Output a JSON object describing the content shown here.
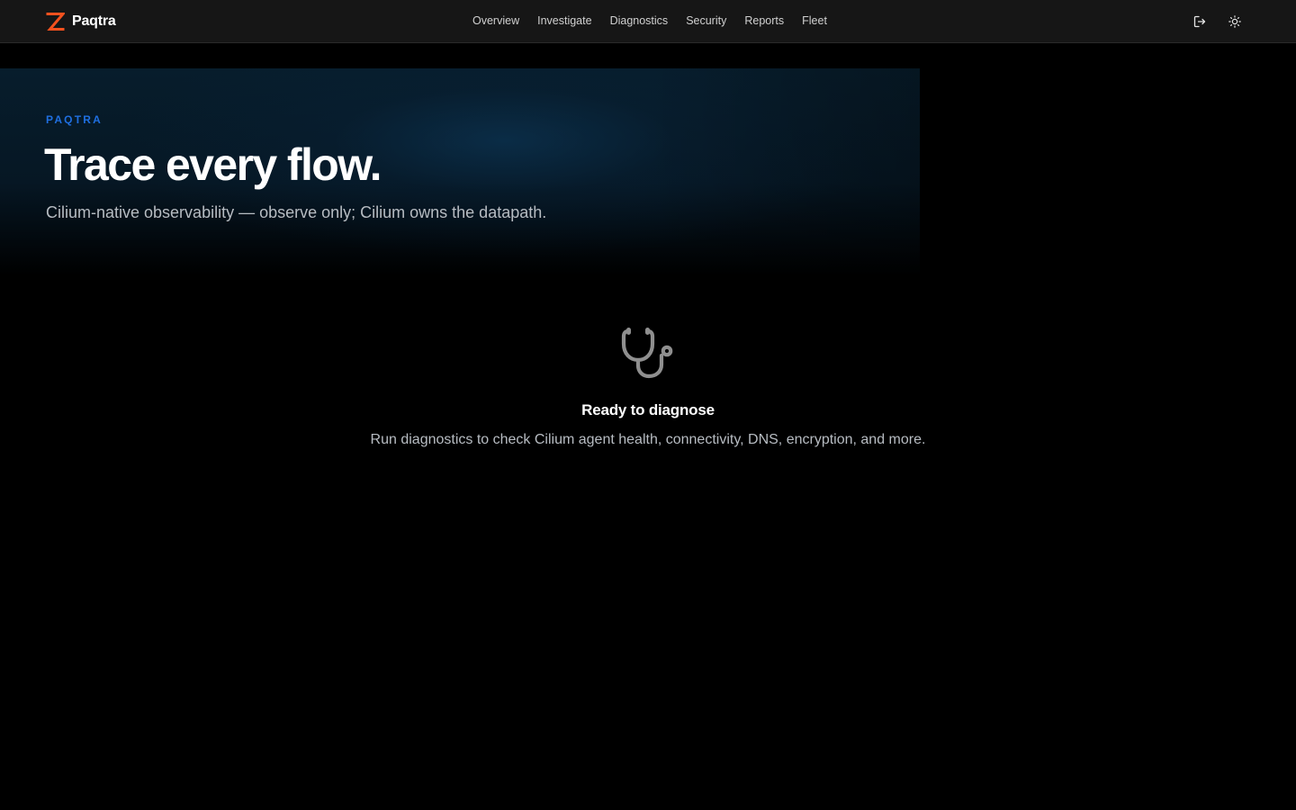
{
  "header": {
    "brand": {
      "name": "Paqtra",
      "logo_icon": "z-logo-icon",
      "logo_color": "#f4511e"
    },
    "nav": [
      {
        "label": "Overview"
      },
      {
        "label": "Investigate"
      },
      {
        "label": "Diagnostics"
      },
      {
        "label": "Security"
      },
      {
        "label": "Reports"
      },
      {
        "label": "Fleet"
      }
    ],
    "actions": {
      "logout_icon": "logout-icon",
      "theme_icon": "sun-icon"
    }
  },
  "hero": {
    "eyebrow": "PAQTRA",
    "title": "Trace every flow.",
    "subtitle": "Cilium-native observability — observe only; Cilium owns the datapath.",
    "accent_color": "#1f6fe0"
  },
  "empty_state": {
    "icon": "stethoscope-icon",
    "title": "Ready to diagnose",
    "description": "Run diagnostics to check Cilium agent health, connectivity, DNS, encryption, and more."
  }
}
